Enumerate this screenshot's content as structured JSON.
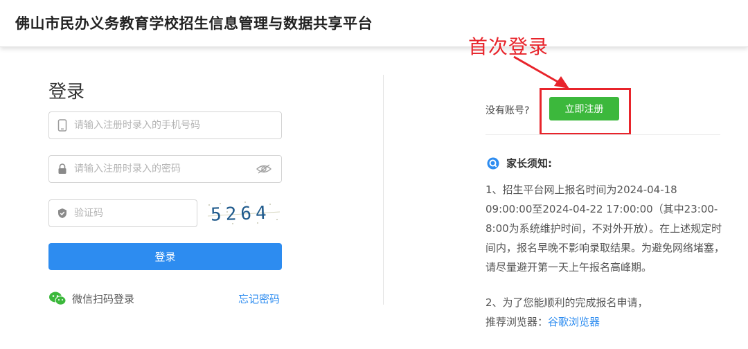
{
  "header": {
    "title": "佛山市民办义务教育学校招生信息管理与数据共享平台"
  },
  "annotation": {
    "label": "首次登录",
    "color": "#e8242b"
  },
  "login": {
    "title": "登录",
    "phone_placeholder": "请输入注册时录入的手机号码",
    "password_placeholder": "请输入注册时录入的密码",
    "captcha_placeholder": "验证码",
    "captcha_text": "5264",
    "submit_label": "登录",
    "wechat_label": "微信扫码登录",
    "forgot_label": "忘记密码"
  },
  "register": {
    "prompt": "没有账号?",
    "button_label": "立即注册"
  },
  "notice": {
    "title": "家长须知:",
    "item1": "1、招生平台网上报名时间为2024-04-18 09:00:00至2024-04-22 17:00:00（其中23:00-8:00为系统维护时间，不对外开放）。在上述规定时间内，报名早晚不影响录取结果。为避免网络堵塞，请尽量避开第一天上午报名高峰期。",
    "item2": "2、为了您能顺利的完成报名申请，",
    "browser_prefix": "推荐浏览器：",
    "browser_link": "谷歌浏览器"
  },
  "colors": {
    "primary": "#2d8cf0",
    "register_green": "#3cb83c",
    "annotation_red": "#e8242b"
  },
  "icons": [
    "phone-icon",
    "lock-icon",
    "shield-icon",
    "eye-slash-icon",
    "wechat-icon",
    "notice-icon"
  ]
}
